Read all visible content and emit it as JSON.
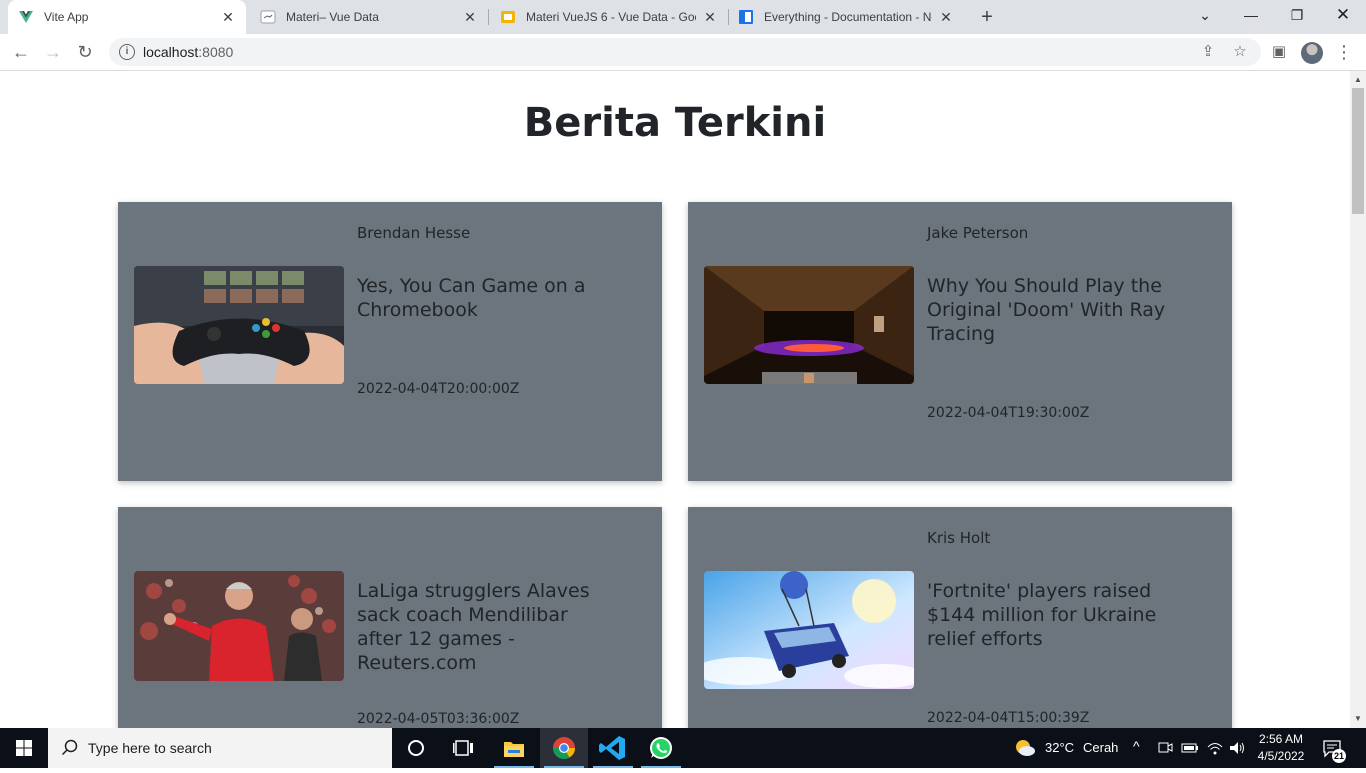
{
  "browser": {
    "tabs": [
      {
        "title": "Vite App",
        "active": true
      },
      {
        "title": "Materi– Vue Data",
        "active": false
      },
      {
        "title": "Materi VueJS 6 - Vue Data - Goo",
        "active": false
      },
      {
        "title": "Everything - Documentation - Ne",
        "active": false
      }
    ],
    "url_host": "localhost",
    "url_port": ":8080"
  },
  "page": {
    "title": "Berita Terkini",
    "articles": [
      {
        "author": "Brendan Hesse",
        "headline": "Yes, You Can Game on a Chromebook",
        "published": "2022-04-04T20:00:00Z",
        "image": "gamepad-photo"
      },
      {
        "author": "Jake Peterson",
        "headline": "Why You Should Play the Original 'Doom' With Ray Tracing",
        "published": "2022-04-04T19:30:00Z",
        "image": "doom-screenshot"
      },
      {
        "author": "",
        "headline": "LaLiga strugglers Alaves sack coach Mendilibar after 12 games - Reuters.com",
        "published": "2022-04-05T03:36:00Z",
        "image": "coach-photo"
      },
      {
        "author": "Kris Holt",
        "headline": "'Fortnite' players raised $144 million for Ukraine relief efforts",
        "published": "2022-04-04T15:00:39Z",
        "image": "fortnite-bus"
      }
    ]
  },
  "taskbar": {
    "search_placeholder": "Type here to search",
    "weather_temp": "32°C",
    "weather_text": "Cerah",
    "time": "2:56 AM",
    "date": "4/5/2022",
    "notification_count": "21"
  },
  "colors": {
    "card_bg": "#6c757d",
    "vue_green": "#41b883",
    "taskbar": "#0b0f17"
  }
}
